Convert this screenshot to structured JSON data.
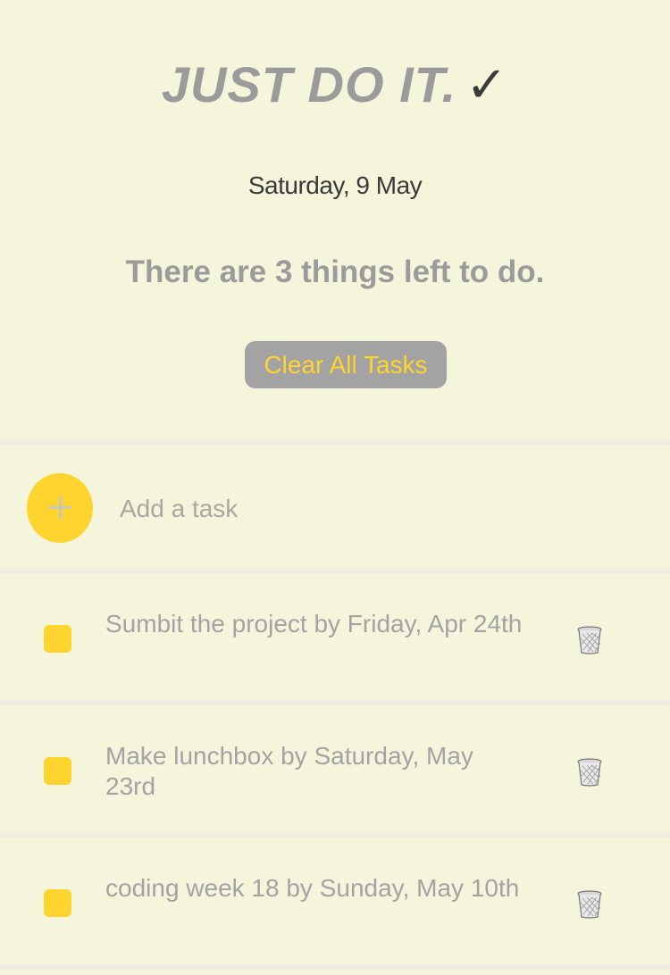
{
  "header": {
    "title": "JUST DO IT.",
    "title_icon": "check-mark-icon",
    "date": "Saturday, 9 May",
    "remaining_text": "There are 3 things left to do.",
    "clear_label": "Clear All Tasks"
  },
  "add_task": {
    "placeholder": "Add a task",
    "icon": "plus-icon"
  },
  "tasks": [
    {
      "text": "Sumbit the project by Friday, Apr 24th",
      "icon": "trash-icon"
    },
    {
      "text": "Make lunchbox by Saturday, May 23rd",
      "icon": "trash-icon"
    },
    {
      "text": "coding week 18 by Sunday, May 10th",
      "icon": "trash-icon"
    }
  ],
  "colors": {
    "background": "#f5f5dc",
    "accent": "#ffd42e",
    "button_bg": "#a3a3a3",
    "text_muted": "#9b9b9b"
  }
}
